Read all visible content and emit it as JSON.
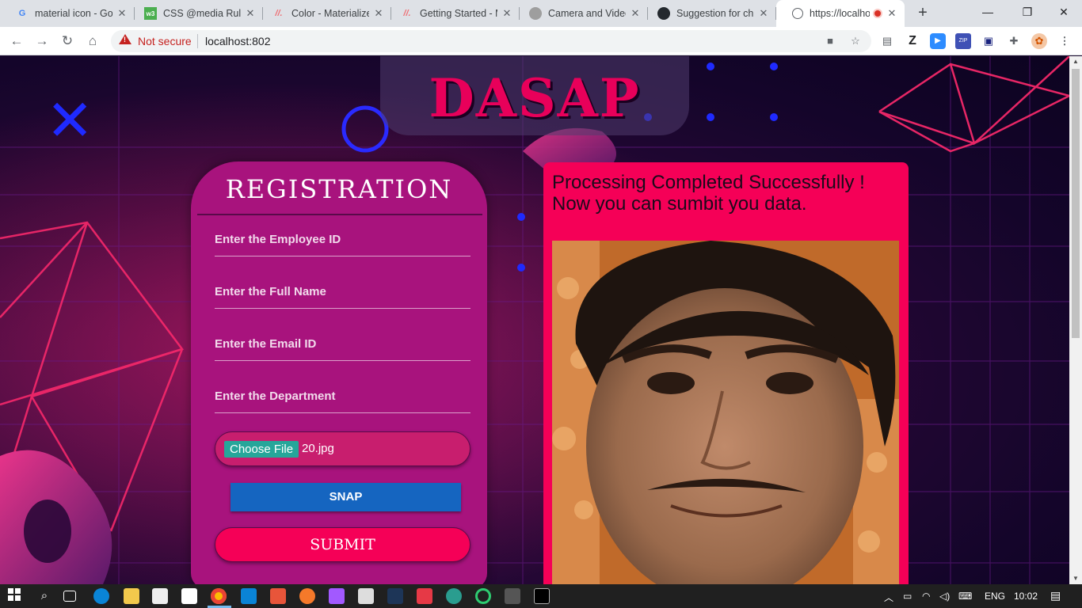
{
  "browser": {
    "tabs": [
      {
        "title": "material icon - Go",
        "icon": "google-icon",
        "color": "#4285f4"
      },
      {
        "title": "CSS @media Rule",
        "icon": "w3schools-icon",
        "color": "#4caf50"
      },
      {
        "title": "Color - Materialize",
        "icon": "materialize-icon",
        "color": "#ee6e73"
      },
      {
        "title": "Getting Started - M",
        "icon": "materialize-icon",
        "color": "#ee6e73"
      },
      {
        "title": "Camera and Video",
        "icon": "site-icon",
        "color": "#9e9e9e"
      },
      {
        "title": "Suggestion for ch",
        "icon": "github-icon",
        "color": "#24292e"
      },
      {
        "title": "https://localho",
        "icon": "globe-icon",
        "color": "#5f6368",
        "active": true
      }
    ],
    "address": {
      "security_label": "Not secure",
      "url": "localhost:802"
    }
  },
  "page": {
    "logo": "DASAP",
    "registration": {
      "title": "REGISTRATION",
      "fields": {
        "employee_id_placeholder": "Enter the Employee ID",
        "full_name_placeholder": "Enter the Full Name",
        "email_placeholder": "Enter the Email ID",
        "department_placeholder": "Enter the Department"
      },
      "file_button": "Choose File",
      "file_name": "20.jpg",
      "snap_button": "SNAP",
      "submit_button": "SUBMIT"
    },
    "result": {
      "message_line1": "Processing Completed Successfully !",
      "message_line2": "Now you can sumbit you data."
    }
  },
  "taskbar": {
    "language": "ENG",
    "time": "10:02"
  },
  "colors": {
    "accent_pink": "#f50057",
    "card_magenta": "#a8137d",
    "snap_blue": "#1565c0",
    "file_teal": "#26a69a"
  }
}
